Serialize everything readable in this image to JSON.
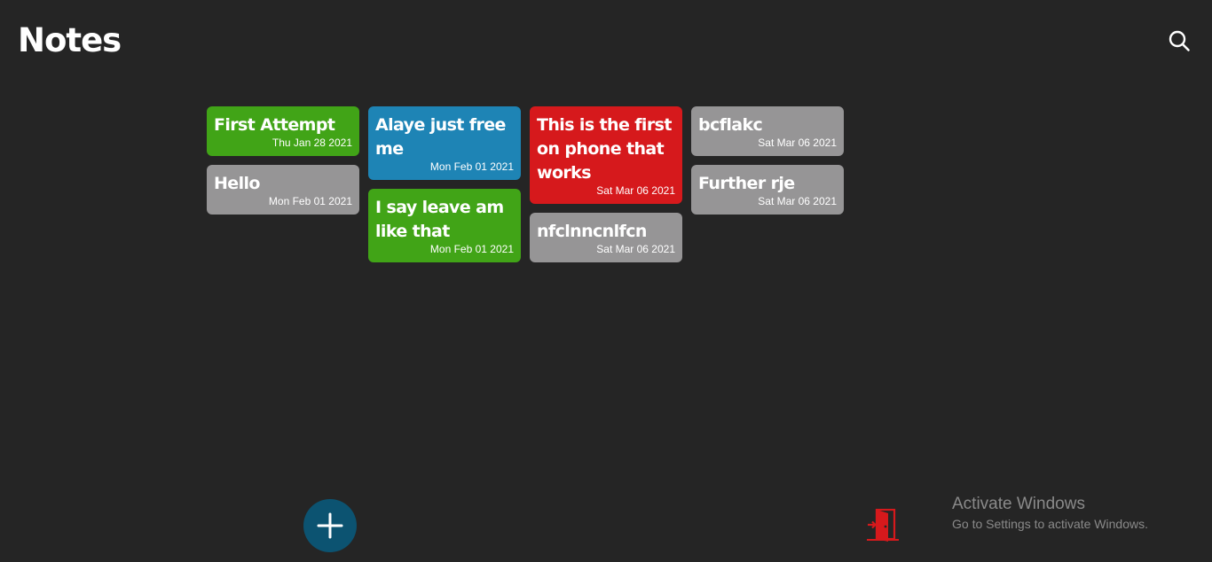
{
  "header": {
    "title": "Notes",
    "search_icon": "search-icon"
  },
  "notes": {
    "columns": [
      [
        {
          "title": "First Attempt",
          "date": "Thu Jan 28 2021",
          "color": "#41a417"
        },
        {
          "title": "Hello",
          "date": "Mon Feb 01 2021",
          "color": "#969596"
        }
      ],
      [
        {
          "title": "Alaye just free me",
          "date": "Mon Feb 01 2021",
          "color": "#1e84b5"
        },
        {
          "title": "I say leave am like that",
          "date": "Mon Feb 01 2021",
          "color": "#41a417"
        }
      ],
      [
        {
          "title": "This is the first on phone that works",
          "date": "Sat Mar 06 2021",
          "color": "#d6191c"
        },
        {
          "title": "nfclnncnlfcn",
          "date": "Sat Mar 06 2021",
          "color": "#969596"
        }
      ],
      [
        {
          "title": "bcflakc",
          "date": "Sat Mar 06 2021",
          "color": "#969596"
        },
        {
          "title": "Further rje",
          "date": "Sat Mar 06 2021",
          "color": "#969596"
        }
      ]
    ]
  },
  "footer": {
    "add_icon": "plus-icon",
    "add_color": "#0c5371",
    "logout_icon": "exit-door-icon",
    "logout_color": "#d6191c"
  },
  "watermark": {
    "title": "Activate Windows",
    "subtitle": "Go to Settings to activate Windows."
  }
}
